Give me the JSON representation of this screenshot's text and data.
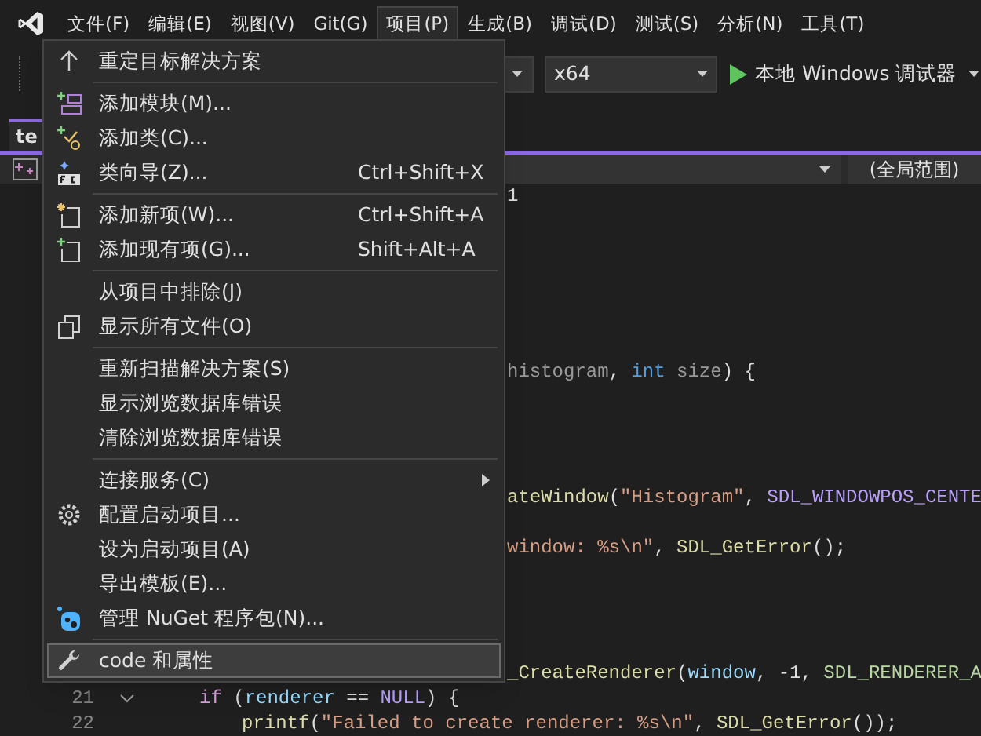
{
  "menubar": [
    {
      "label": "文件(F)",
      "selected": false
    },
    {
      "label": "编辑(E)",
      "selected": false
    },
    {
      "label": "视图(V)",
      "selected": false
    },
    {
      "label": "Git(G)",
      "selected": false
    },
    {
      "label": "项目(P)",
      "selected": true
    },
    {
      "label": "生成(B)",
      "selected": false
    },
    {
      "label": "调试(D)",
      "selected": false
    },
    {
      "label": "测试(S)",
      "selected": false
    },
    {
      "label": "分析(N)",
      "selected": false
    },
    {
      "label": "工具(T)",
      "selected": false
    }
  ],
  "toolbar": {
    "platform": "x64",
    "run_button": "本地 Windows 调试器"
  },
  "tab": {
    "label": "te"
  },
  "navigation_bar": {
    "scope": "(全局范围)"
  },
  "menu": [
    {
      "kind": "arrow",
      "label": "重定目标解决方案",
      "selected": false
    },
    {
      "kind": "separator"
    },
    {
      "kind": "module",
      "label": "添加模块(M)...",
      "selected": false
    },
    {
      "kind": "class",
      "label": "添加类(C)...",
      "selected": false
    },
    {
      "kind": "wizard",
      "label": "类向导(Z)...",
      "shortcut": "Ctrl+Shift+X",
      "selected": false
    },
    {
      "kind": "separator"
    },
    {
      "kind": "newitem",
      "label": "添加新项(W)...",
      "shortcut": "Ctrl+Shift+A",
      "selected": false
    },
    {
      "kind": "existing",
      "label": "添加现有项(G)...",
      "shortcut": "Shift+Alt+A",
      "selected": false
    },
    {
      "kind": "separator"
    },
    {
      "kind": "text",
      "label": "从项目中排除(J)",
      "selected": false
    },
    {
      "kind": "files",
      "label": "显示所有文件(O)",
      "selected": false
    },
    {
      "kind": "separator"
    },
    {
      "kind": "text",
      "label": "重新扫描解决方案(S)",
      "selected": false
    },
    {
      "kind": "text",
      "label": "显示浏览数据库错误",
      "selected": false
    },
    {
      "kind": "text",
      "label": "清除浏览数据库错误",
      "selected": false
    },
    {
      "kind": "separator"
    },
    {
      "kind": "text",
      "label": "连接服务(C)",
      "submenu": true,
      "selected": false
    },
    {
      "kind": "gear",
      "label": "配置启动项目...",
      "selected": false
    },
    {
      "kind": "text",
      "label": "设为启动项目(A)",
      "selected": false
    },
    {
      "kind": "text",
      "label": "导出模板(E)...",
      "selected": false
    },
    {
      "kind": "package",
      "label": "管理 NuGet 程序包(N)...",
      "selected": false
    },
    {
      "kind": "separator"
    },
    {
      "kind": "wrench",
      "label": "code 和属性",
      "selected": true
    }
  ],
  "code_rows": [
    {
      "kind": "partial",
      "segments": [
        {
          "kind": "plain",
          "text": "1"
        }
      ]
    },
    {
      "kind": "blank"
    },
    {
      "kind": "blank"
    },
    {
      "kind": "blank"
    },
    {
      "kind": "blank"
    },
    {
      "kind": "blank"
    },
    {
      "kind": "blank"
    },
    {
      "kind": "partial",
      "segments": [
        {
          "kind": "param",
          "text": "histogram"
        },
        {
          "kind": "plain",
          "text": ", "
        },
        {
          "kind": "keyword",
          "text": "int"
        },
        {
          "kind": "param",
          "text": " size"
        },
        {
          "kind": "plain",
          "text": ") {"
        }
      ]
    },
    {
      "kind": "blank"
    },
    {
      "kind": "blank"
    },
    {
      "kind": "blank"
    },
    {
      "kind": "blank"
    },
    {
      "kind": "partial",
      "segments": [
        {
          "kind": "function",
          "text": "ateWindow"
        },
        {
          "kind": "plain",
          "text": "("
        },
        {
          "kind": "string",
          "text": "\"Histogram\""
        },
        {
          "kind": "plain",
          "text": ", "
        },
        {
          "kind": "macro",
          "text": "SDL_WINDOWPOS_CENTE"
        }
      ]
    },
    {
      "kind": "blank"
    },
    {
      "kind": "partial",
      "segments": [
        {
          "kind": "string",
          "text": "window: %s\\n\""
        },
        {
          "kind": "plain",
          "text": ", "
        },
        {
          "kind": "function",
          "text": "SDL_GetError"
        },
        {
          "kind": "plain",
          "text": "();"
        }
      ]
    },
    {
      "kind": "blank"
    },
    {
      "kind": "blank"
    },
    {
      "kind": "blank"
    },
    {
      "kind": "blank"
    },
    {
      "kind": "partial",
      "segments": [
        {
          "kind": "function",
          "text": "_CreateRenderer"
        },
        {
          "kind": "plain",
          "text": "("
        },
        {
          "kind": "variable",
          "text": "window"
        },
        {
          "kind": "plain",
          "text": ", -1, "
        },
        {
          "kind": "enum",
          "text": "SDL_RENDERER_A"
        }
      ]
    },
    {
      "kind": "numbered",
      "number": "21",
      "expanded": true,
      "segments": [
        {
          "kind": "control",
          "text": "if"
        },
        {
          "kind": "plain",
          "text": " ("
        },
        {
          "kind": "variable",
          "text": "renderer"
        },
        {
          "kind": "plain",
          "text": " == "
        },
        {
          "kind": "macro",
          "text": "NULL"
        },
        {
          "kind": "plain",
          "text": ") {"
        }
      ],
      "children": [
        {
          "kind": "numbered",
          "number": "22",
          "segments": [
            {
              "kind": "function",
              "text": "printf"
            },
            {
              "kind": "plain",
              "text": "("
            },
            {
              "kind": "string",
              "text": "\"Failed to create renderer: %s\\n\""
            },
            {
              "kind": "plain",
              "text": ", "
            },
            {
              "kind": "function",
              "text": "SDL_GetError"
            },
            {
              "kind": "plain",
              "text": "());"
            }
          ]
        }
      ]
    }
  ]
}
